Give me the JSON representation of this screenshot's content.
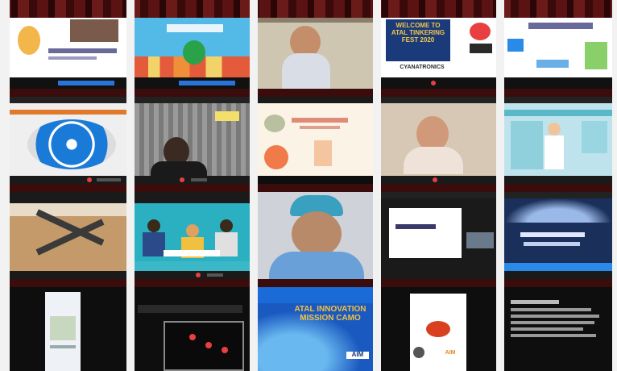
{
  "window": {
    "title": ""
  },
  "tiles": [
    {
      "row": 1,
      "col": 1,
      "caption": ""
    },
    {
      "row": 1,
      "col": 2,
      "caption": ""
    },
    {
      "row": 1,
      "col": 3,
      "caption": ""
    },
    {
      "row": 1,
      "col": 4,
      "caption": "WELCOME TO ATAL TINKERING FEST 2020",
      "footer": "CYANATRONICS"
    },
    {
      "row": 1,
      "col": 5,
      "caption": ""
    },
    {
      "row": 2,
      "col": 1,
      "caption": ""
    },
    {
      "row": 2,
      "col": 2,
      "caption": ""
    },
    {
      "row": 2,
      "col": 3,
      "caption": ""
    },
    {
      "row": 2,
      "col": 4,
      "caption": ""
    },
    {
      "row": 2,
      "col": 5,
      "caption": ""
    },
    {
      "row": 3,
      "col": 1,
      "caption": ""
    },
    {
      "row": 3,
      "col": 2,
      "caption": ""
    },
    {
      "row": 3,
      "col": 3,
      "caption": ""
    },
    {
      "row": 3,
      "col": 4,
      "caption": ""
    },
    {
      "row": 3,
      "col": 5,
      "caption": ""
    },
    {
      "row": 4,
      "col": 1,
      "caption": ""
    },
    {
      "row": 4,
      "col": 2,
      "caption": ""
    },
    {
      "row": 4,
      "col": 3,
      "caption": "ATAL INNOVATION MISSION CAMO",
      "badge": "AIM"
    },
    {
      "row": 4,
      "col": 4,
      "caption": "",
      "badge": "AIM"
    },
    {
      "row": 4,
      "col": 5,
      "caption": ""
    }
  ],
  "colors": {
    "accent": "#1e6fd6",
    "record": "#e84040",
    "frame": "#f2f2f2"
  }
}
